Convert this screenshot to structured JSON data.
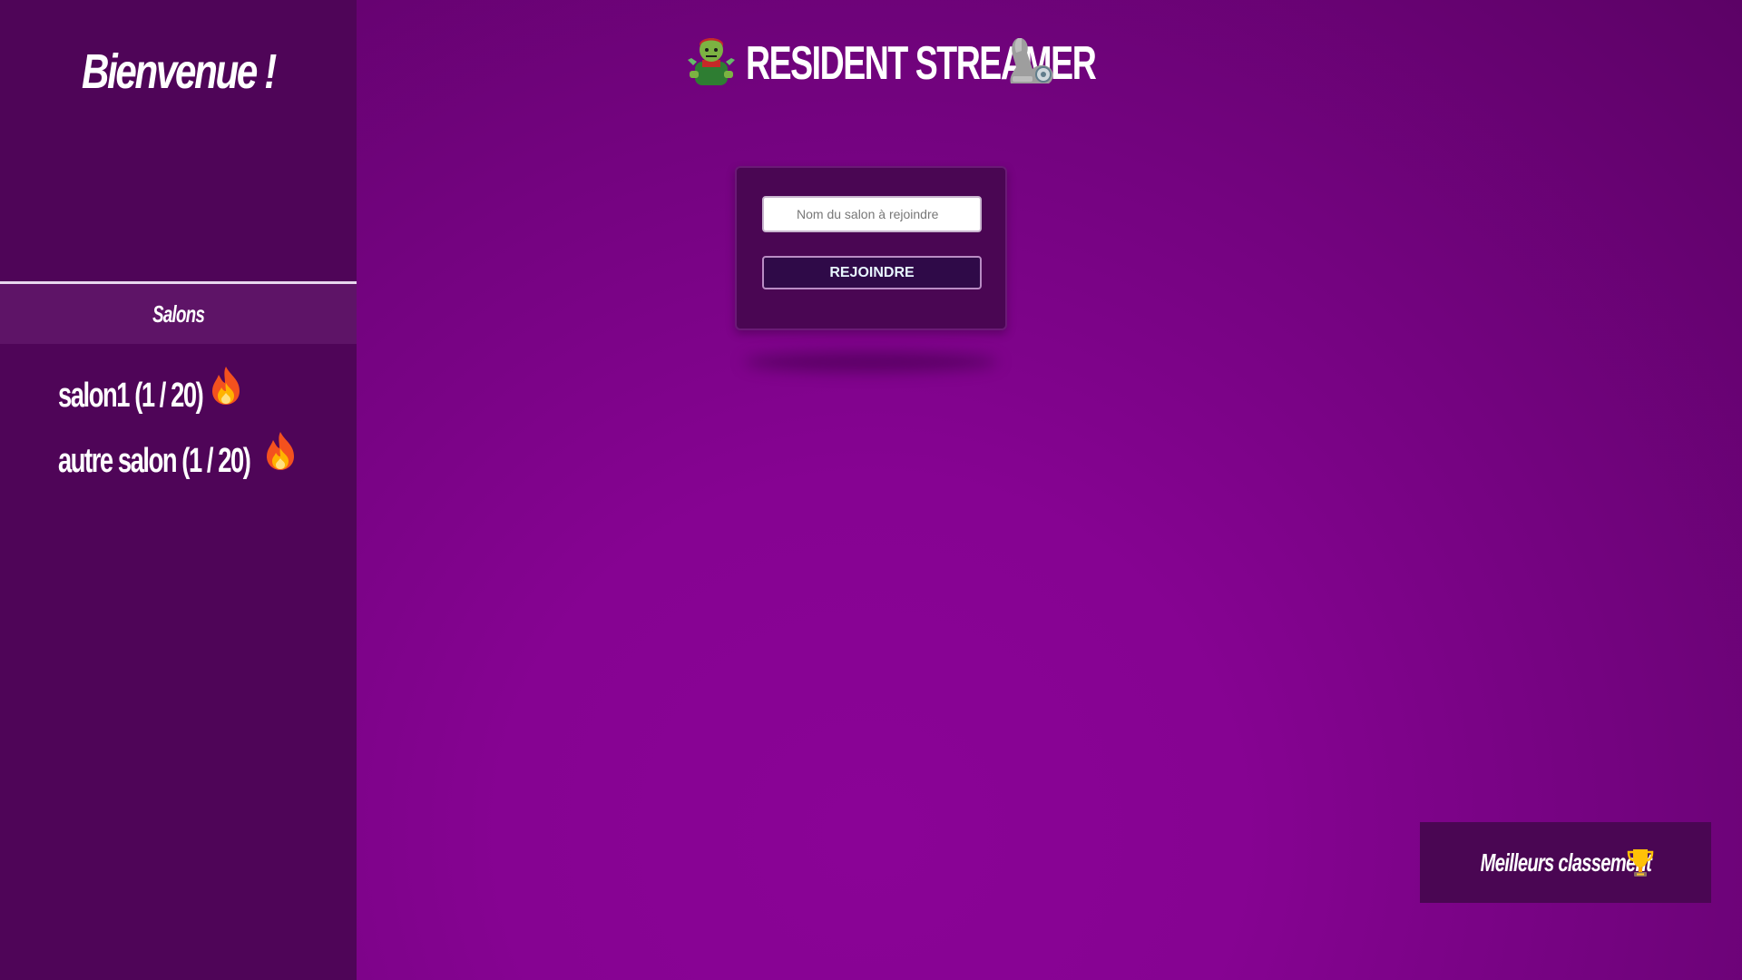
{
  "sidebar": {
    "welcome": "Bienvenue !",
    "salons_title": "Salons",
    "rooms": [
      {
        "label": "salon1 (1 / 20)",
        "icon": "fire-icon"
      },
      {
        "label": "autre salon  (1 / 20)",
        "icon": "fire-icon"
      }
    ]
  },
  "header": {
    "title": "RESIDENT STREAMER",
    "left_icon": "zombie-icon",
    "right_icon": "mechanical-arm-icon"
  },
  "join": {
    "placeholder": "Nom du salon à rejoindre",
    "button_label": "REJOINDRE"
  },
  "leaderboard": {
    "label": "Meilleurs classement",
    "icon": "trophy-icon"
  },
  "colors": {
    "background": "#860392",
    "sidebar": "#4f0558",
    "card": "#4a0653",
    "button": "#2f0a48"
  }
}
